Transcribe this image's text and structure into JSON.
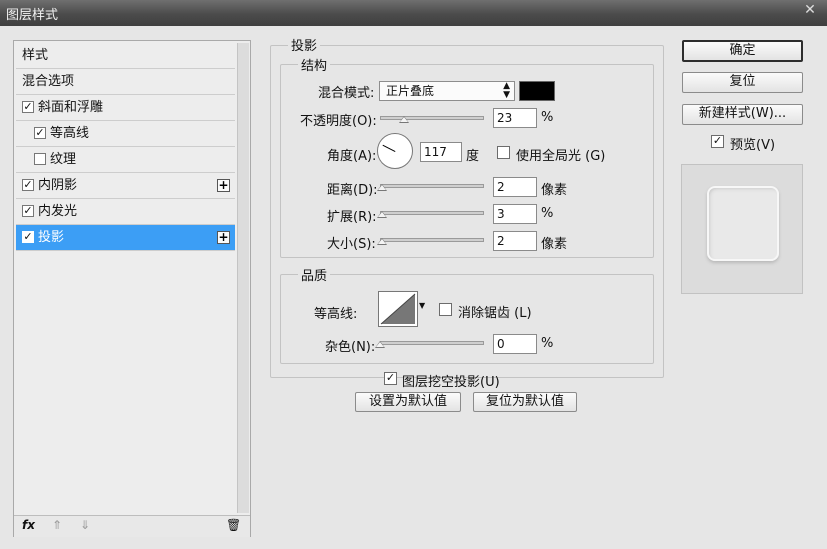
{
  "window": {
    "title": "图层样式",
    "close_glyph": "✕"
  },
  "style_list": {
    "items": [
      {
        "label": "样式",
        "checkbox": false,
        "checked": false,
        "has_plus": false,
        "selected": false
      },
      {
        "label": "混合选项",
        "checkbox": false,
        "checked": false,
        "has_plus": false,
        "selected": false
      },
      {
        "label": "斜面和浮雕",
        "checkbox": true,
        "checked": true,
        "has_plus": false,
        "selected": false
      },
      {
        "label": "等高线",
        "checkbox": true,
        "checked": true,
        "has_plus": false,
        "selected": false
      },
      {
        "label": "纹理",
        "checkbox": true,
        "checked": false,
        "has_plus": false,
        "selected": false
      },
      {
        "label": "内阴影",
        "checkbox": true,
        "checked": true,
        "has_plus": true,
        "selected": false
      },
      {
        "label": "内发光",
        "checkbox": true,
        "checked": true,
        "has_plus": false,
        "selected": false
      },
      {
        "label": "投影",
        "checkbox": true,
        "checked": true,
        "has_plus": true,
        "selected": true
      }
    ],
    "footer": {
      "fx": "fx",
      "up": "⇑",
      "down": "⇓",
      "trash": "🗑"
    }
  },
  "drop_shadow": {
    "section_title": "投影",
    "structure": {
      "title": "结构",
      "blend_mode_label": "混合模式:",
      "blend_mode_value": "正片叠底",
      "shadow_color": "#000000",
      "opacity_label": "不透明度(O):",
      "opacity_value": "23",
      "opacity_unit": "%",
      "opacity_fraction": 0.23,
      "angle_label": "角度(A):",
      "angle_value": "117",
      "angle_unit": "度",
      "global_light_label": "使用全局光 (G)",
      "global_light_checked": false,
      "distance_label": "距离(D):",
      "distance_value": "2",
      "distance_unit": "像素",
      "spread_label": "扩展(R):",
      "spread_value": "3",
      "spread_unit": "%",
      "size_label": "大小(S):",
      "size_value": "2",
      "size_unit": "像素"
    },
    "quality": {
      "title": "品质",
      "contour_label": "等高线:",
      "anti_alias_label": "消除锯齿 (L)",
      "anti_alias_checked": false,
      "noise_label": "杂色(N):",
      "noise_value": "0",
      "noise_unit": "%"
    },
    "knockout_label": "图层挖空投影(U)",
    "knockout_checked": true,
    "make_default": "设置为默认值",
    "reset_default": "复位为默认值"
  },
  "right_panel": {
    "ok": "确定",
    "reset": "复位",
    "new_style": "新建样式(W)...",
    "preview_label": "预览(V)",
    "preview_checked": true
  }
}
